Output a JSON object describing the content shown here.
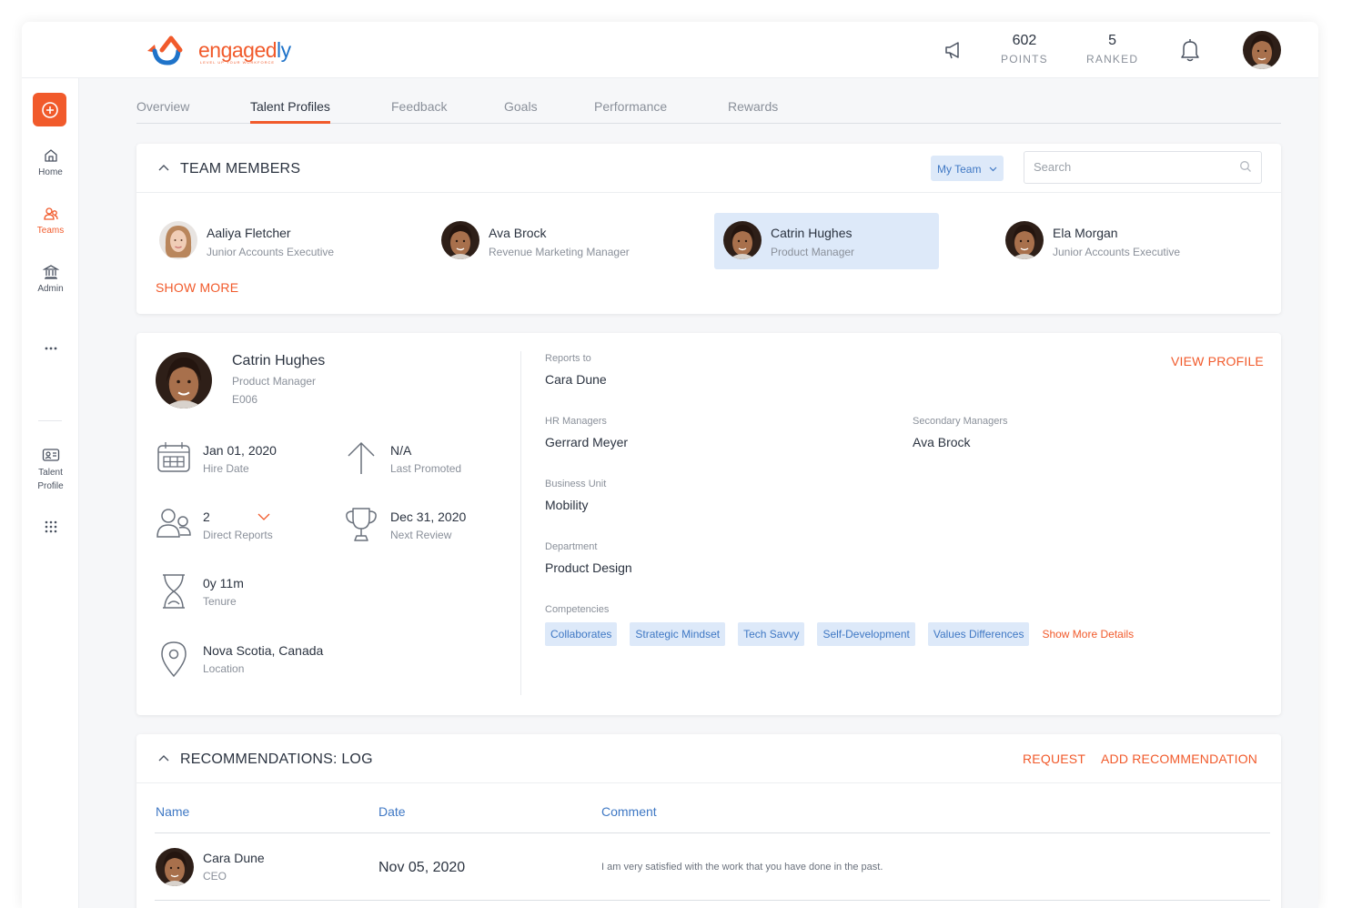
{
  "brand": {
    "name_main": "engaged",
    "name_accent": "ly",
    "tagline": "LEVEL UP YOUR WORKFORCE"
  },
  "header": {
    "points_value": "602",
    "points_label": "POINTS",
    "ranked_value": "5",
    "ranked_label": "RANKED",
    "icons": [
      "megaphone-icon",
      "bell-icon",
      "user-avatar"
    ]
  },
  "sidebar": {
    "items": [
      {
        "label": "Home",
        "icon": "home-icon"
      },
      {
        "label": "Teams",
        "icon": "teams-icon",
        "active": true
      },
      {
        "label": "Admin",
        "icon": "admin-icon"
      },
      {
        "label": "Talent Profile",
        "icon": "id-card-icon"
      }
    ]
  },
  "tabs": [
    "Overview",
    "Talent Profiles",
    "Feedback",
    "Goals",
    "Performance",
    "Rewards"
  ],
  "active_tab": "Talent Profiles",
  "team": {
    "title": "TEAM MEMBERS",
    "filter": "My Team",
    "search_placeholder": "Search",
    "show_more": "SHOW MORE",
    "members": [
      {
        "name": "Aaliya Fletcher",
        "role": "Junior Accounts Executive"
      },
      {
        "name": "Ava Brock",
        "role": "Revenue Marketing Manager"
      },
      {
        "name": "Catrin Hughes",
        "role": "Product Manager",
        "selected": true
      },
      {
        "name": "Ela Morgan",
        "role": "Junior Accounts Executive"
      }
    ]
  },
  "profile": {
    "name": "Catrin Hughes",
    "role": "Product Manager",
    "id": "E006",
    "hire_date": "Jan 01, 2020",
    "hire_date_label": "Hire Date",
    "last_promoted": "N/A",
    "last_promoted_label": "Last Promoted",
    "direct_reports": "2",
    "direct_reports_label": "Direct Reports",
    "next_review": "Dec 31, 2020",
    "next_review_label": "Next Review",
    "tenure": "0y 11m",
    "tenure_label": "Tenure",
    "location": "Nova Scotia, Canada",
    "location_label": "Location",
    "view_profile": "VIEW PROFILE",
    "reports_to_label": "Reports to",
    "reports_to": "Cara Dune",
    "hr_managers_label": "HR Managers",
    "hr_managers": "Gerrard Meyer",
    "secondary_managers_label": "Secondary Managers",
    "secondary_managers": "Ava Brock",
    "business_unit_label": "Business Unit",
    "business_unit": "Mobility",
    "department_label": "Department",
    "department": "Product Design",
    "competencies_label": "Competencies",
    "competencies": [
      "Collaborates",
      "Strategic Mindset",
      "Tech Savvy",
      "Self-Development",
      "Values Differences"
    ],
    "show_more_details": "Show More Details"
  },
  "recommendations": {
    "title": "RECOMMENDATIONS: LOG",
    "request": "REQUEST",
    "add": "ADD RECOMMENDATION",
    "columns": [
      "Name",
      "Date",
      "Comment"
    ],
    "rows": [
      {
        "name": "Cara Dune",
        "title": "CEO",
        "date": "Nov 05, 2020",
        "comment": "I am very satisfied with the work that you have done in the past."
      }
    ]
  },
  "colors": {
    "accent": "#f15a2b",
    "link_blue": "#3f78c4",
    "chip_bg": "#dde9f9"
  }
}
